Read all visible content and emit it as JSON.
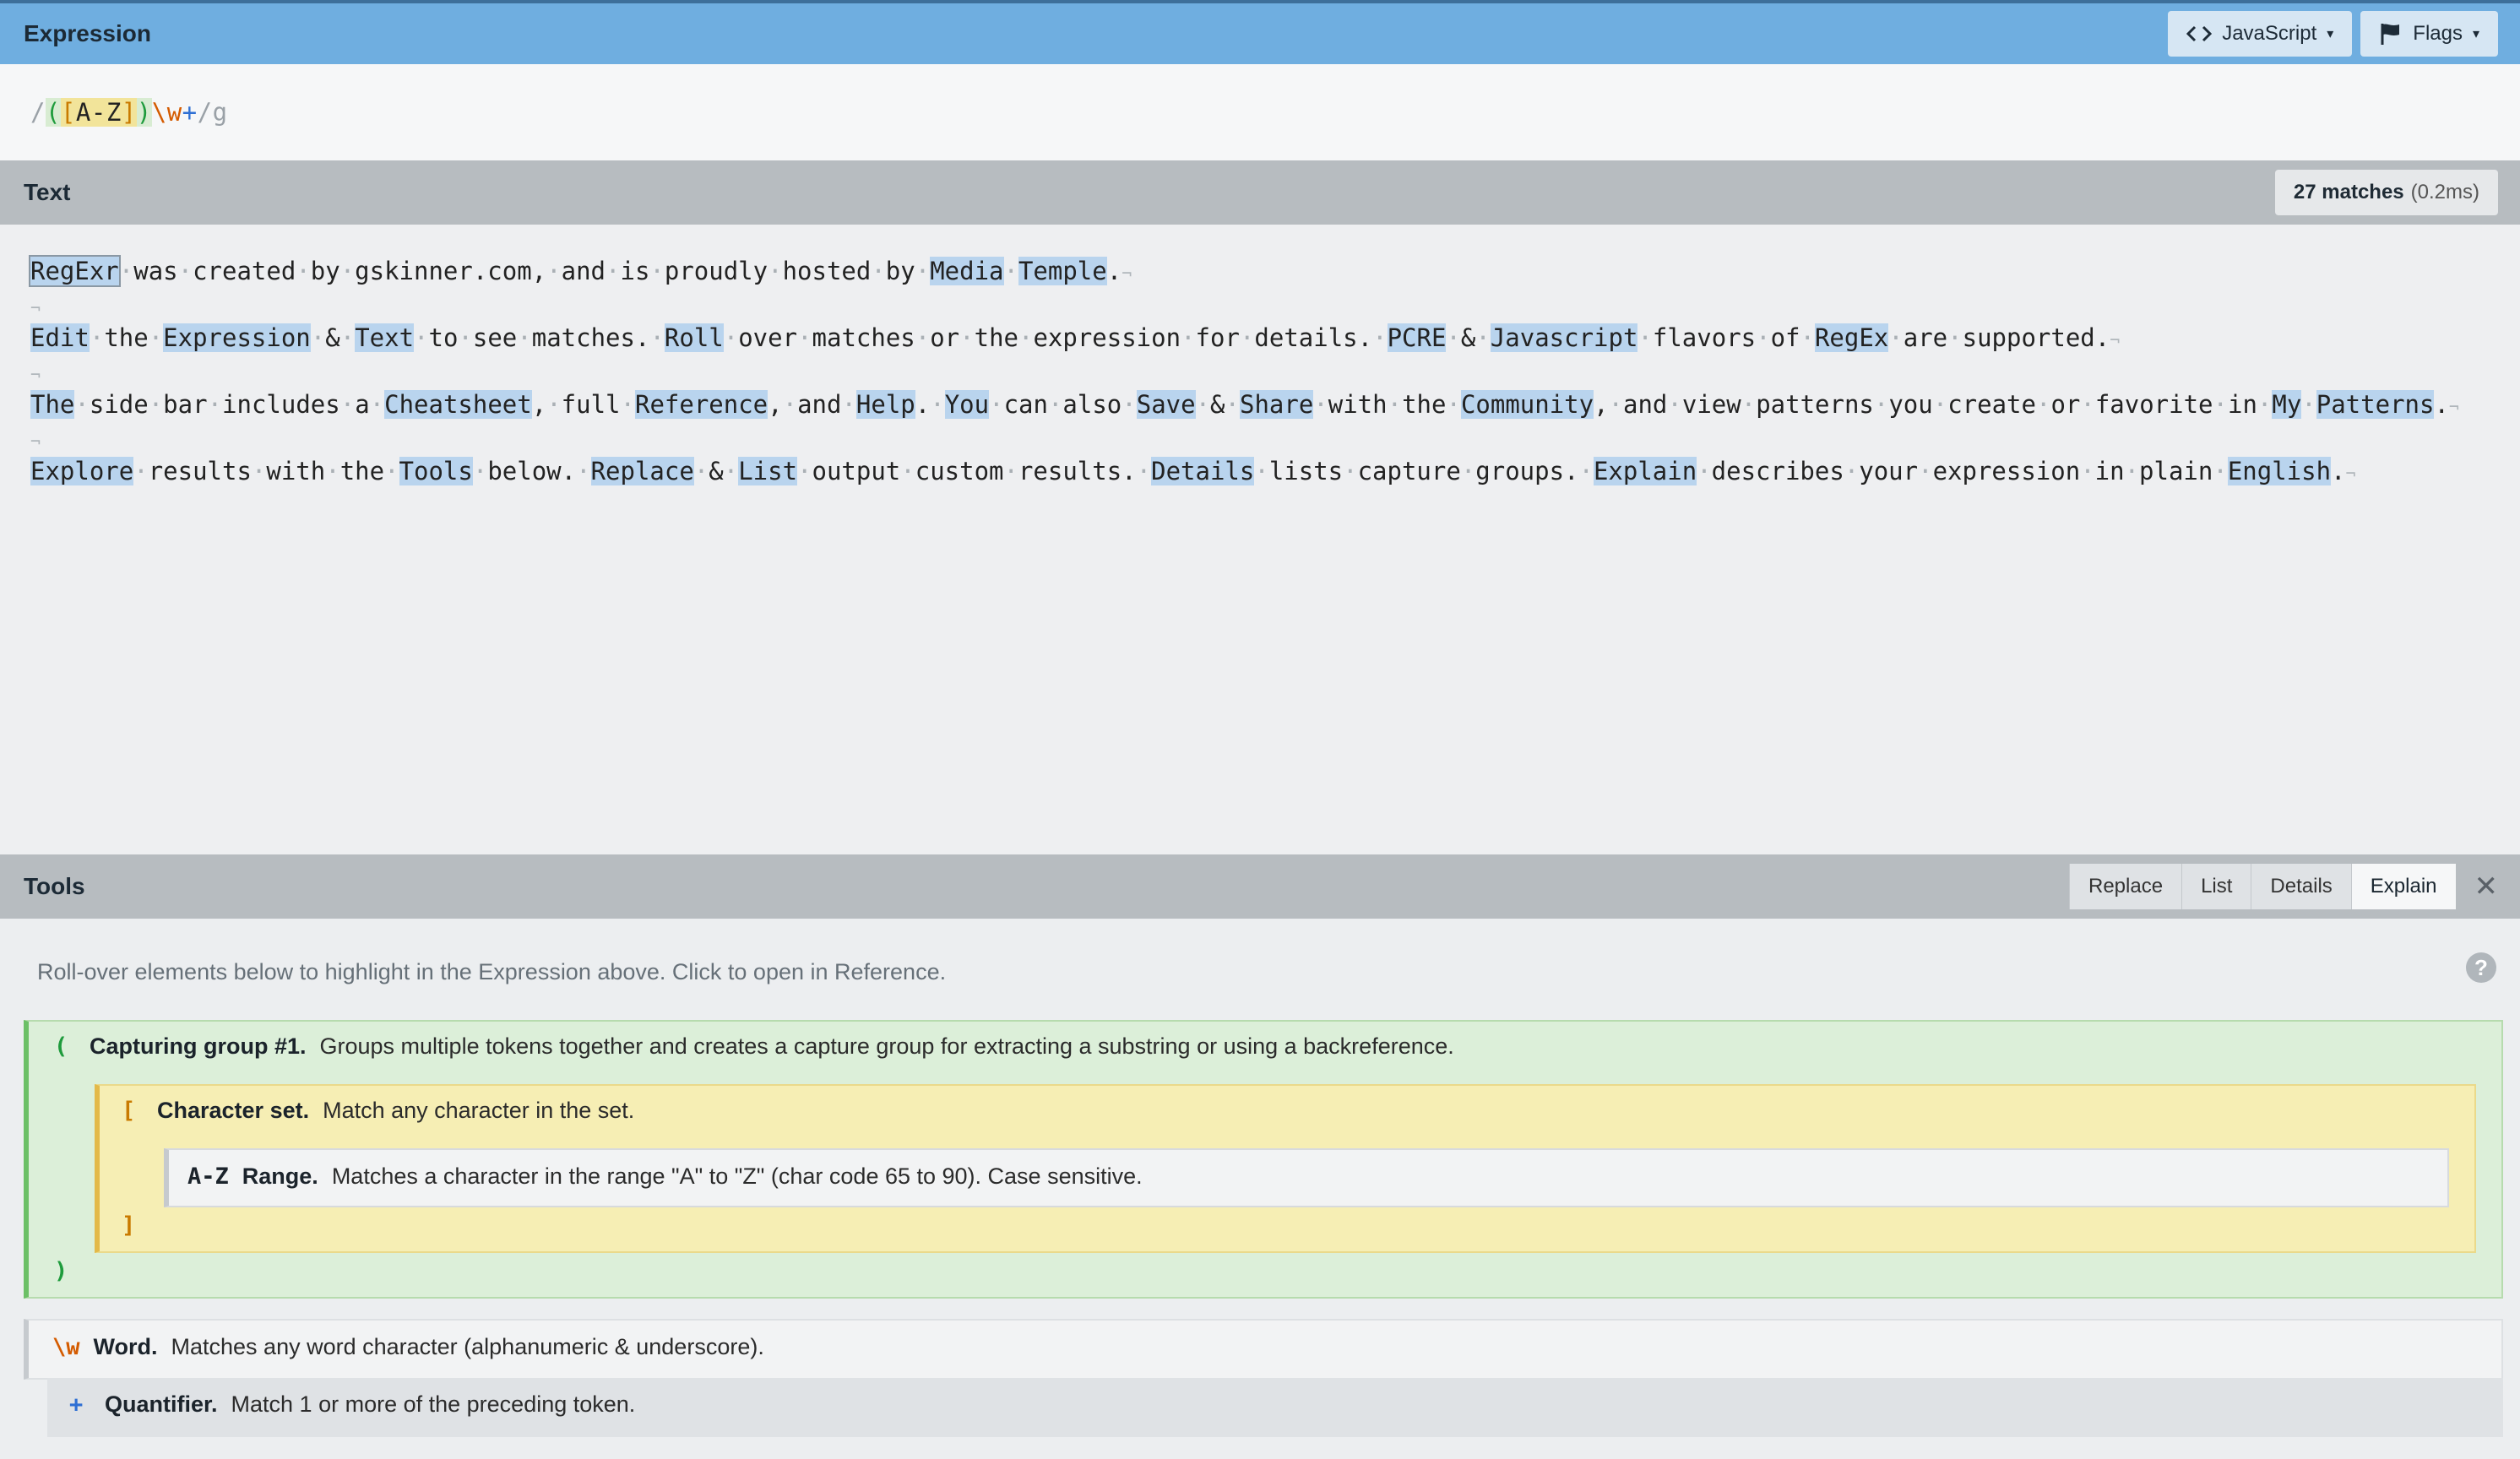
{
  "expression": {
    "title": "Expression",
    "language_button": "JavaScript",
    "flags_button": "Flags",
    "regex": {
      "open_delim": "/",
      "group_open": "(",
      "set_open": "[",
      "range": "A-Z",
      "set_close": "]",
      "group_close": ")",
      "escape": "\\w",
      "quantifier": "+",
      "close_delim": "/",
      "flags": "g"
    }
  },
  "text": {
    "title": "Text",
    "match_count": "27 matches",
    "match_time": "(0.2ms)",
    "paragraphs": [
      [
        {
          "t": "RegExr",
          "m": true,
          "first": true
        },
        " ",
        "was",
        " ",
        "created",
        " ",
        "by",
        " ",
        "gskinner.com,",
        " ",
        "and",
        " ",
        "is",
        " ",
        "proudly",
        " ",
        "hosted",
        " ",
        "by",
        " ",
        {
          "t": "Media",
          "m": true
        },
        " ",
        {
          "t": "Temple",
          "m": true
        },
        "."
      ],
      [
        {
          "t": "Edit",
          "m": true
        },
        " ",
        "the",
        " ",
        {
          "t": "Expression",
          "m": true
        },
        " ",
        "&",
        " ",
        {
          "t": "Text",
          "m": true
        },
        " ",
        "to",
        " ",
        "see",
        " ",
        "matches.",
        " ",
        {
          "t": "Roll",
          "m": true
        },
        " ",
        "over",
        " ",
        "matches",
        " ",
        "or",
        " ",
        "the",
        " ",
        "expression",
        " ",
        "for",
        " ",
        "details.",
        " ",
        {
          "t": "PCRE",
          "m": true
        },
        " ",
        "&",
        " ",
        {
          "t": "Javascript",
          "m": true
        },
        " ",
        "flavors",
        " ",
        "of",
        " ",
        {
          "t": "RegEx",
          "m": true
        },
        " ",
        "are",
        " ",
        "supported."
      ],
      [
        {
          "t": "The",
          "m": true
        },
        " ",
        "side",
        " ",
        "bar",
        " ",
        "includes",
        " ",
        "a",
        " ",
        {
          "t": "Cheatsheet",
          "m": true
        },
        ",",
        " ",
        "full",
        " ",
        {
          "t": "Reference",
          "m": true
        },
        ",",
        " ",
        "and",
        " ",
        {
          "t": "Help",
          "m": true
        },
        ".",
        " ",
        {
          "t": "You",
          "m": true
        },
        " ",
        "can",
        " ",
        "also",
        " ",
        {
          "t": "Save",
          "m": true
        },
        " ",
        "&",
        " ",
        {
          "t": "Share",
          "m": true
        },
        " ",
        "with",
        " ",
        "the",
        " ",
        {
          "t": "Community",
          "m": true
        },
        ",",
        " ",
        "and",
        " ",
        "view",
        " ",
        "patterns",
        " ",
        "you",
        " ",
        "create",
        " ",
        "or",
        " ",
        "favorite",
        " ",
        "in",
        " ",
        {
          "t": "My",
          "m": true
        },
        " ",
        {
          "t": "Patterns",
          "m": true
        },
        "."
      ],
      [
        {
          "t": "Explore",
          "m": true
        },
        " ",
        "results",
        " ",
        "with",
        " ",
        "the",
        " ",
        {
          "t": "Tools",
          "m": true
        },
        " ",
        "below.",
        " ",
        {
          "t": "Replace",
          "m": true
        },
        " ",
        "&",
        " ",
        {
          "t": "List",
          "m": true
        },
        " ",
        "output",
        " ",
        "custom",
        " ",
        "results.",
        " ",
        {
          "t": "Details",
          "m": true
        },
        " ",
        "lists",
        " ",
        "capture",
        " ",
        "groups.",
        " ",
        {
          "t": "Explain",
          "m": true
        },
        " ",
        "describes",
        " ",
        "your",
        " ",
        "expression",
        " ",
        "in",
        " ",
        "plain",
        " ",
        {
          "t": "English",
          "m": true
        },
        "."
      ]
    ]
  },
  "tools": {
    "title": "Tools",
    "tabs": [
      "Replace",
      "List",
      "Details",
      "Explain"
    ],
    "active_tab": "Explain",
    "close_label": "✕",
    "hint": "Roll-over elements below to highlight in the Expression above. Click to open in Reference.",
    "help_label": "?",
    "explain": {
      "group": {
        "open": "(",
        "close": ")",
        "name": "Capturing group #1.",
        "desc": "Groups multiple tokens together and creates a capture group for extracting a substring or using a backreference."
      },
      "set": {
        "open": "[",
        "close": "]",
        "name": "Character set.",
        "desc": "Match any character in the set."
      },
      "range": {
        "token": "A-Z",
        "name": "Range.",
        "desc": "Matches a character in the range \"A\" to \"Z\" (char code 65 to 90). Case sensitive."
      },
      "word": {
        "token": "\\w",
        "name": "Word.",
        "desc": "Matches any word character (alphanumeric & underscore)."
      },
      "quantifier": {
        "token": "+",
        "name": "Quantifier.",
        "desc": "Match 1 or more of the preceding token."
      }
    }
  },
  "colors": {
    "expression_bar": "#6faee0",
    "match_highlight": "#b9d4ee",
    "group_green": "#1e9b3c",
    "set_orange": "#c97a00",
    "escape_orange": "#d45b00",
    "quantifier_blue": "#2e6fd4"
  }
}
